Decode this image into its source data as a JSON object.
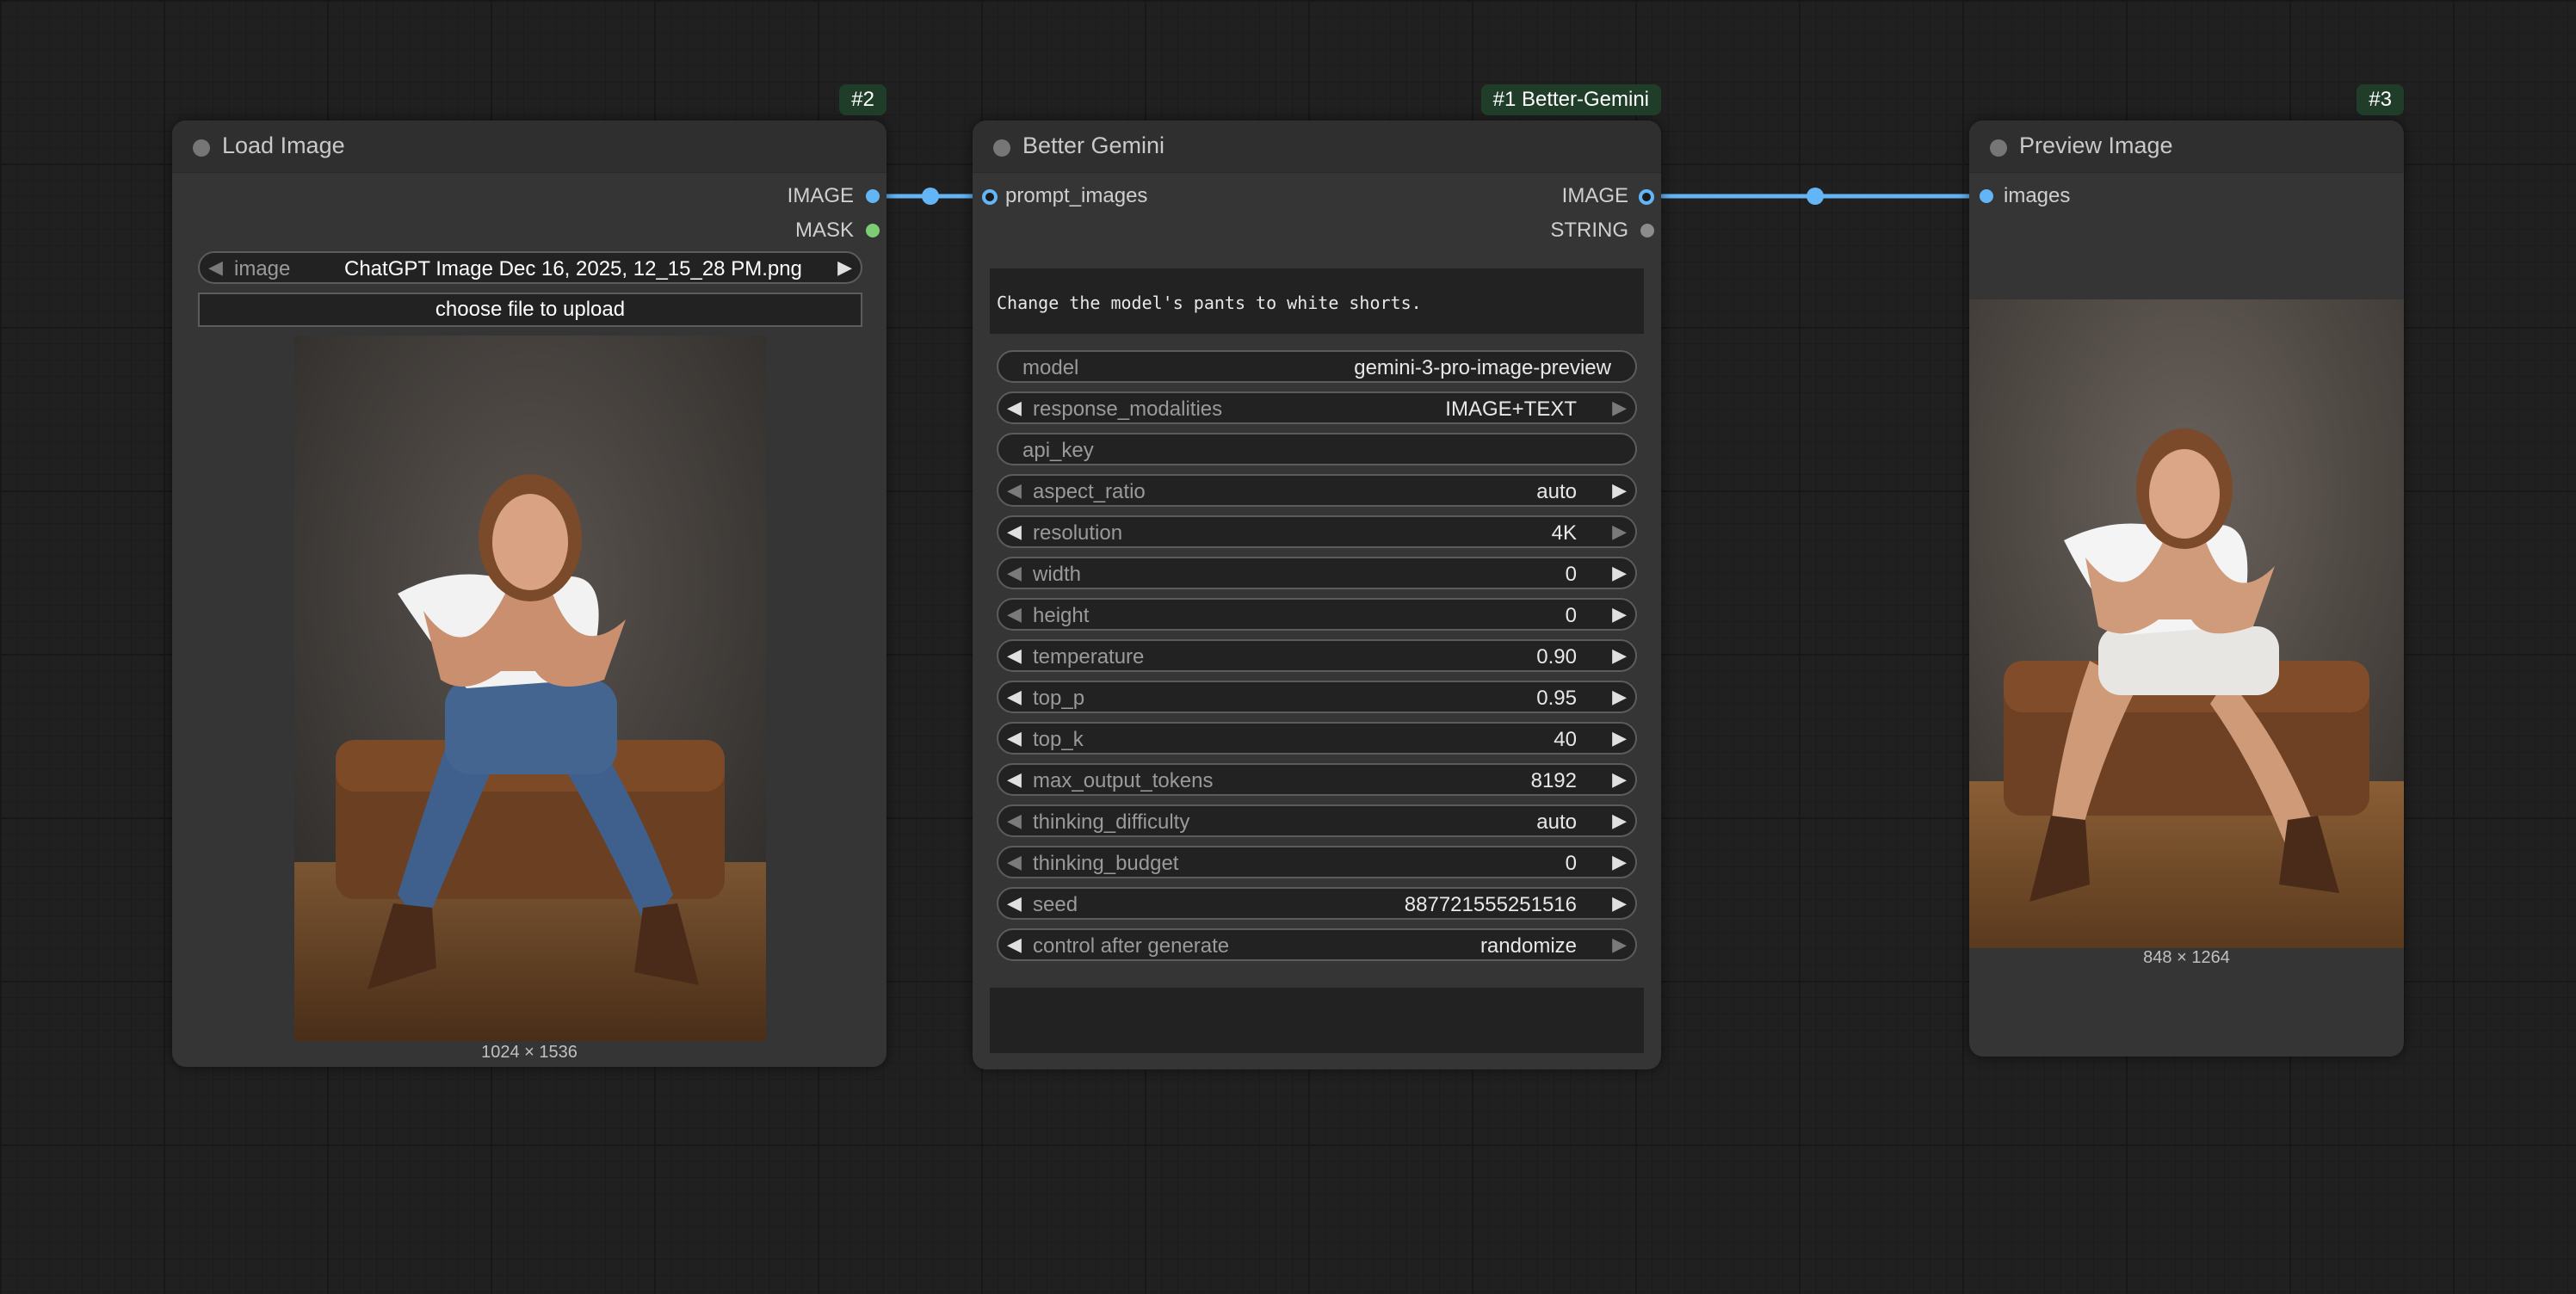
{
  "nodes": {
    "load_image": {
      "badge": "#2",
      "title": "Load Image",
      "outputs": [
        "IMAGE",
        "MASK"
      ],
      "image_widget": {
        "label": "image",
        "value": "ChatGPT Image Dec 16, 2025, 12_15_28 PM.png"
      },
      "upload_label": "choose file to upload",
      "dimensions": "1024 × 1536"
    },
    "better_gemini": {
      "badge": "#1 Better-Gemini",
      "title": "Better Gemini",
      "input": "prompt_images",
      "outputs": [
        "IMAGE",
        "STRING"
      ],
      "prompt": "Change the model's pants to white shorts.",
      "widgets": {
        "model": {
          "label": "model",
          "value": "gemini-3-pro-image-preview"
        },
        "response_modalities": {
          "label": "response_modalities",
          "value": "IMAGE+TEXT"
        },
        "api_key": {
          "label": "api_key",
          "value": ""
        },
        "aspect_ratio": {
          "label": "aspect_ratio",
          "value": "auto"
        },
        "resolution": {
          "label": "resolution",
          "value": "4K"
        },
        "width": {
          "label": "width",
          "value": "0"
        },
        "height": {
          "label": "height",
          "value": "0"
        },
        "temperature": {
          "label": "temperature",
          "value": "0.90"
        },
        "top_p": {
          "label": "top_p",
          "value": "0.95"
        },
        "top_k": {
          "label": "top_k",
          "value": "40"
        },
        "max_output_tokens": {
          "label": "max_output_tokens",
          "value": "8192"
        },
        "thinking_difficulty": {
          "label": "thinking_difficulty",
          "value": "auto"
        },
        "thinking_budget": {
          "label": "thinking_budget",
          "value": "0"
        },
        "seed": {
          "label": "seed",
          "value": "887721555251516"
        },
        "control_after_generate": {
          "label": "control after generate",
          "value": "randomize"
        }
      }
    },
    "preview_image": {
      "badge": "#3",
      "title": "Preview Image",
      "input": "images",
      "dimensions": "848 × 1264"
    }
  },
  "colors": {
    "link": "#64b5f6",
    "image_slot": "#64b5f6",
    "mask_slot": "#7ccd73",
    "badge_bg": "#1f3d28"
  },
  "icons": {
    "arrow_left": "left-arrow-icon",
    "arrow_right": "right-arrow-icon",
    "status_dot": "node-status-dot-icon"
  }
}
